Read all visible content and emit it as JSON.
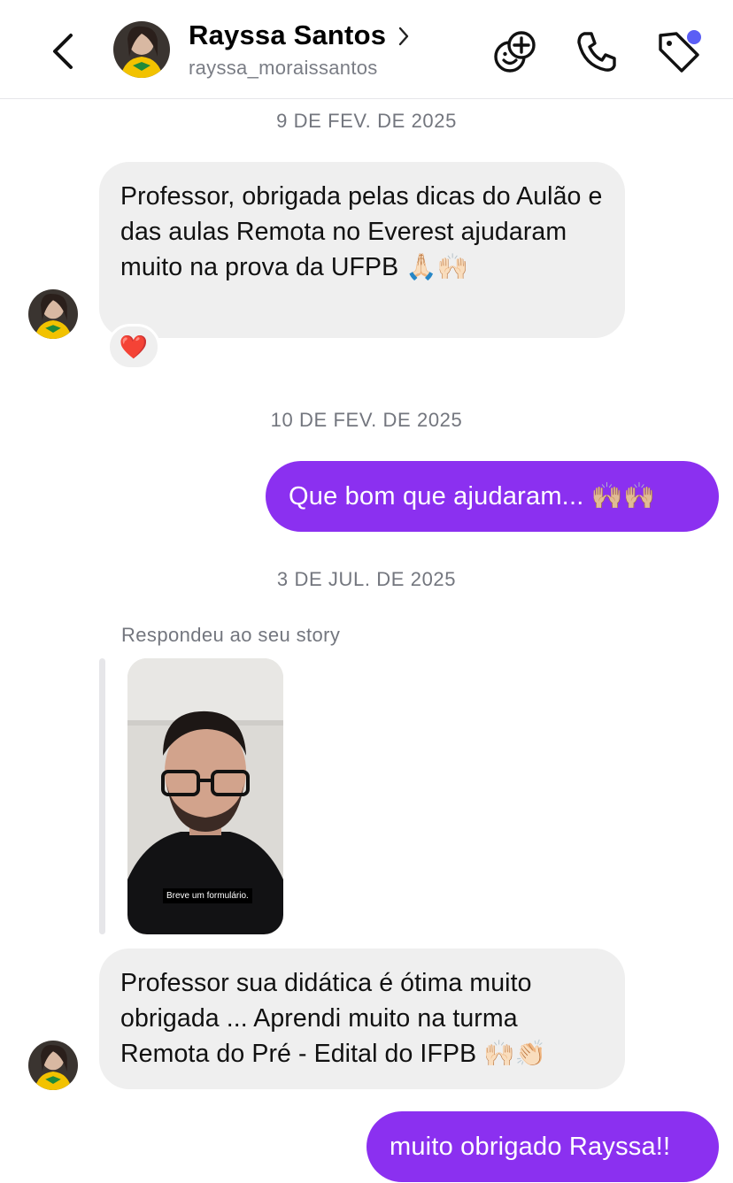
{
  "header": {
    "name": "Rayssa Santos",
    "username": "rayssa_moraissantos",
    "icons": [
      "back-icon",
      "chevron-right-icon",
      "add-friend-emoji-icon",
      "phone-icon",
      "tag-icon"
    ],
    "notification_color": "#5b5ef5"
  },
  "colors": {
    "outgoing_bubble": "#8b30f0",
    "incoming_bubble": "#efefef"
  },
  "messages": [
    {
      "type": "date",
      "text": "9 DE FEV. DE 2025"
    },
    {
      "type": "incoming",
      "text": "Professor, obrigada pelas dicas do Aulão e das aulas Remota no Everest ajudaram muito na prova da UFPB 🙏🏻🙌🏻",
      "reaction": "❤️"
    },
    {
      "type": "date",
      "text": "10 DE FEV. DE 2025"
    },
    {
      "type": "outgoing",
      "text": "Que bom que ajudaram... 🙌🏼🙌🏼"
    },
    {
      "type": "date",
      "text": "3 DE JUL. DE 2025"
    },
    {
      "type": "story_reply",
      "label": "Respondeu ao seu story",
      "story_caption": "Breve um formulário."
    },
    {
      "type": "incoming",
      "text": "Professor sua didática é ótima muito obrigada ... Aprendi muito na turma Remota do Pré - Edital do IFPB 🙌🏻👏🏻"
    },
    {
      "type": "outgoing",
      "text": "muito obrigado Rayssa!!"
    }
  ]
}
